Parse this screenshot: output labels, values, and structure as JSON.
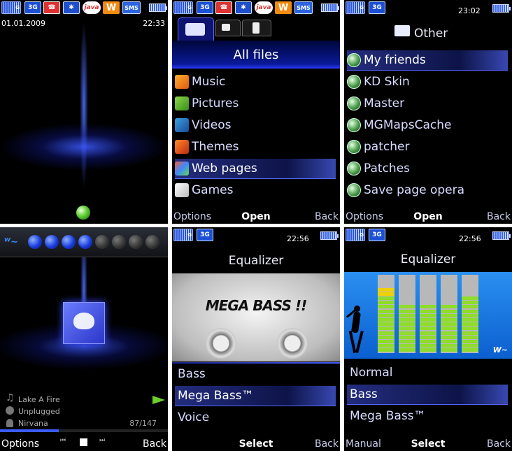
{
  "screen1": {
    "date": "01.01.2009",
    "time": "22:33",
    "status_icons": [
      "signal-icon",
      "3g-icon",
      "missed-call-icon",
      "bluetooth-icon",
      "java-icon",
      "walkman-icon",
      "sms-icon",
      "battery-icon"
    ],
    "g_label": "G",
    "g3_label": "3G",
    "java_label": "java",
    "sms_label": "SMS"
  },
  "screen2": {
    "tabs": [
      "phone-memory-tab",
      "memory-card-tab",
      "phone-tab"
    ],
    "title": "All files",
    "items": [
      {
        "label": "Music",
        "icon": "music-icon",
        "selected": false
      },
      {
        "label": "Pictures",
        "icon": "pictures-icon",
        "selected": false
      },
      {
        "label": "Videos",
        "icon": "videos-icon",
        "selected": false
      },
      {
        "label": "Themes",
        "icon": "themes-icon",
        "selected": false
      },
      {
        "label": "Web pages",
        "icon": "web-pages-icon",
        "selected": true
      },
      {
        "label": "Games",
        "icon": "games-icon",
        "selected": false
      }
    ],
    "softkeys": {
      "left": "Options",
      "center": "Open",
      "right": "Back"
    }
  },
  "screen3": {
    "time": "23:02",
    "title": "Other",
    "items": [
      {
        "label": "My friends",
        "selected": true
      },
      {
        "label": "KD Skin",
        "selected": false
      },
      {
        "label": "Master",
        "selected": false
      },
      {
        "label": "MGMapsCache",
        "selected": false
      },
      {
        "label": "patcher",
        "selected": false
      },
      {
        "label": "Patches",
        "selected": false
      },
      {
        "label": "Save page opera",
        "selected": false
      }
    ],
    "softkeys": {
      "left": "Options",
      "center": "Open",
      "right": "Back"
    }
  },
  "screen4": {
    "track": "Lake A Fire",
    "album": "Unplugged",
    "artist": "Nirvana",
    "track_count": "87/147",
    "volume_level": 4,
    "volume_steps": 8,
    "progress": 0.35,
    "softkeys": {
      "left": "Options",
      "right": "Back"
    }
  },
  "screen5": {
    "time": "22:56",
    "title": "Equalizer",
    "banner_text": "MEGA BASS !!",
    "items": [
      {
        "label": "Bass",
        "selected": false
      },
      {
        "label": "Mega Bass™",
        "selected": true
      },
      {
        "label": "Voice",
        "selected": false
      }
    ],
    "softkeys": {
      "center": "Select",
      "right": "Back"
    }
  },
  "screen6": {
    "time": "22:56",
    "title": "Equalizer",
    "band_levels": [
      0.82,
      0.6,
      0.6,
      0.6,
      0.7
    ],
    "items": [
      {
        "label": "Normal",
        "selected": false
      },
      {
        "label": "Bass",
        "selected": true
      },
      {
        "label": "Mega Bass™",
        "selected": false
      }
    ],
    "softkeys": {
      "left": "Manual",
      "center": "Select",
      "right": "Back"
    }
  },
  "colors": {
    "accent": "#2a3ccc",
    "highlight": "#1a2490",
    "text": "#d8dcff",
    "eq_green": "#8fdc2a",
    "eq_yellow": "#f0d000",
    "eq_bg": "#0b6fd8"
  }
}
